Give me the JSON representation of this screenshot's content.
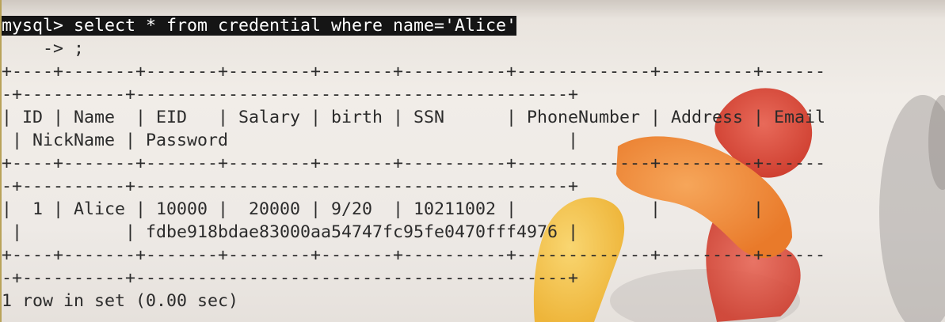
{
  "terminal": {
    "command_line": "mysql> select * from credential where name='Alice'",
    "continuation_line": "    -> ;",
    "border_top_a": "+----+-------+-------+--------+-------+----------+-------------+---------+------",
    "border_top_b": "-+----------+------------------------------------------+",
    "header_a": "| ID | Name  | EID   | Salary | birth | SSN      | PhoneNumber | Address | Email",
    "header_b": " | NickName | Password                                 |",
    "border_mid_a": "+----+-------+-------+--------+-------+----------+-------------+---------+------",
    "border_mid_b": "-+----------+------------------------------------------+",
    "row_a": "|  1 | Alice | 10000 |  20000 | 9/20  | 10211002 |             |         |",
    "row_b": " |          | fdbe918bdae83000aa54747fc95fe0470fff4976 |",
    "border_bot_a": "+----+-------+-------+--------+-------+----------+-------------+---------+------",
    "border_bot_b": "-+----------+------------------------------------------+",
    "result_line": "1 row in set (0.00 sec)"
  },
  "colors": {
    "background": "#efebe7",
    "text": "#2b2b2b",
    "highlight_bg": "#151515",
    "highlight_fg": "#ffffff",
    "logo_red": "#dd4f3e",
    "logo_orange": "#ef8b3a",
    "logo_yellow": "#f4c44a"
  }
}
